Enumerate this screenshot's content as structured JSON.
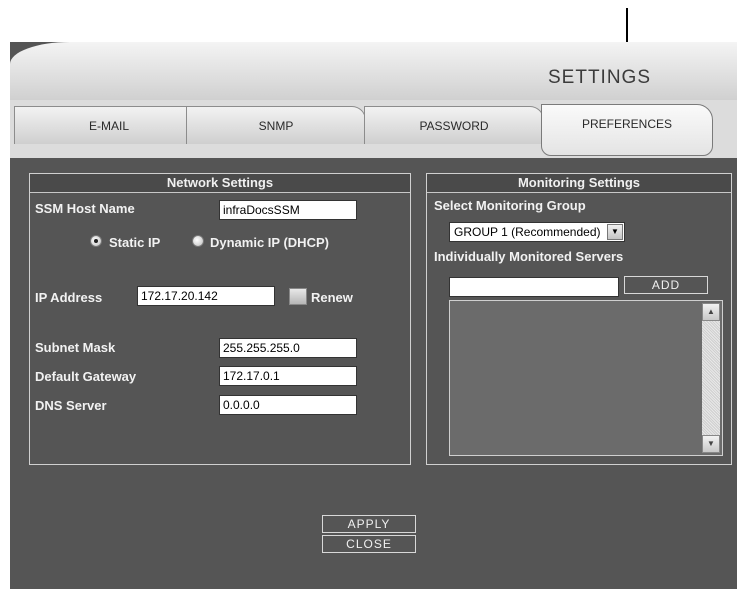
{
  "header": {
    "title": "SETTINGS"
  },
  "tabs": [
    {
      "label": "E-MAIL"
    },
    {
      "label": "SNMP"
    },
    {
      "label": "PASSWORD"
    },
    {
      "label": "PREFERENCES",
      "active": true
    }
  ],
  "network": {
    "title": "Network Settings",
    "host_label": "SSM Host Name",
    "host_value": "infraDocsSSM",
    "static_label": "Static IP",
    "dynamic_label": "Dynamic IP (DHCP)",
    "ip_mode": "static",
    "ip_label": "IP Address",
    "ip_value": "172.17.20.142",
    "renew_label": "Renew",
    "subnet_label": "Subnet Mask",
    "subnet_value": "255.255.255.0",
    "gateway_label": "Default Gateway",
    "gateway_value": "172.17.0.1",
    "dns_label": "DNS Server",
    "dns_value": "0.0.0.0"
  },
  "monitoring": {
    "title": "Monitoring Settings",
    "group_label": "Select Monitoring Group",
    "group_value": "GROUP 1 (Recommended)",
    "servers_label": "Individually Monitored Servers",
    "server_input": "",
    "add_label": "ADD"
  },
  "actions": {
    "apply": "APPLY",
    "close": "CLOSE"
  }
}
